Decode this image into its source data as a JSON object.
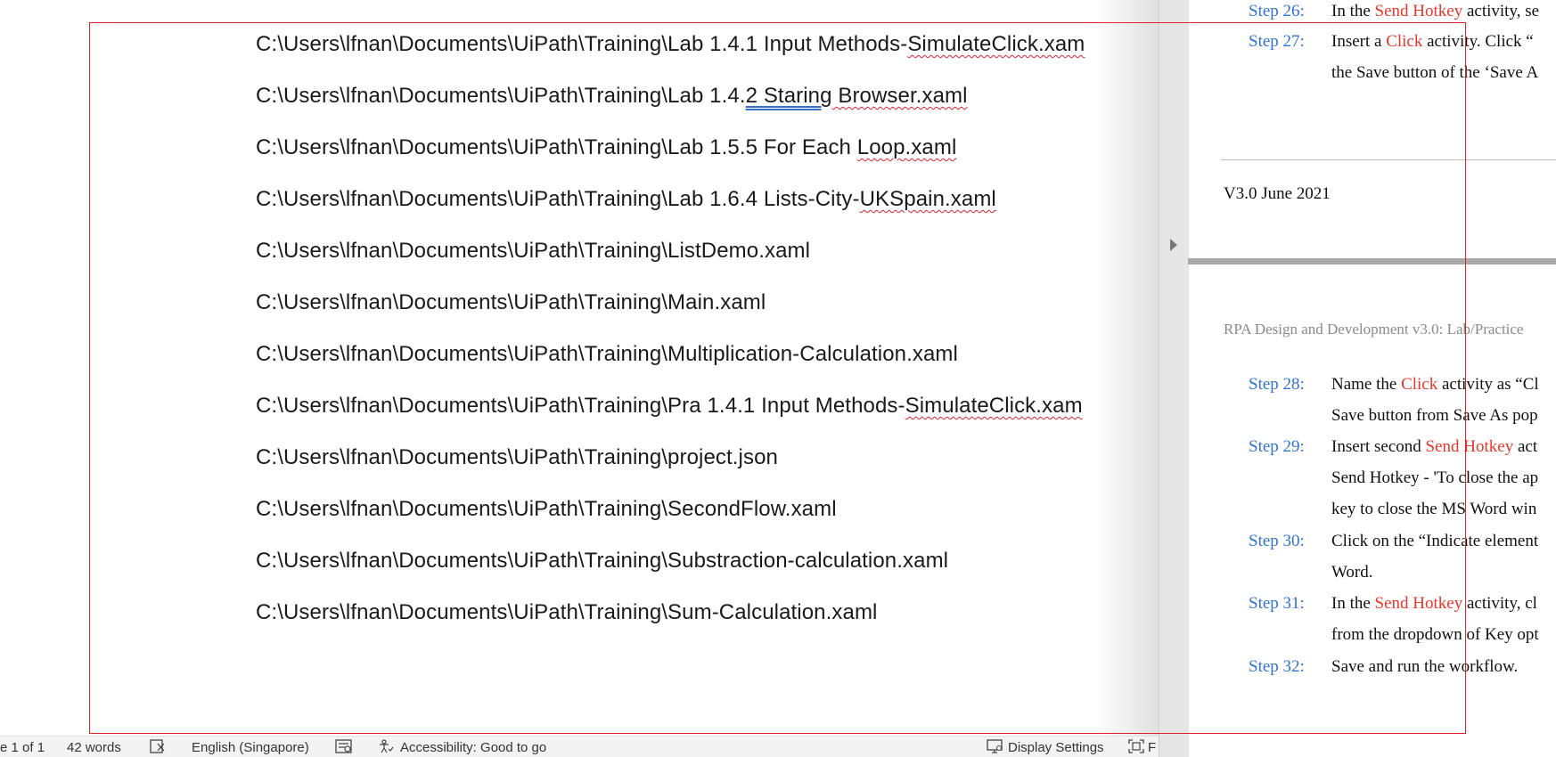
{
  "document": {
    "paths": [
      {
        "prefix": "C:\\Users\\lfnan\\Documents\\UiPath\\Training\\Lab 1.4.1 Input Methods-",
        "flag": "SimulateClick.xam",
        "suffix": ""
      },
      {
        "prefix": "C:\\Users\\lfnan\\Documents\\UiPath\\Training\\Lab 1.4.",
        "flag": "2  Staring",
        "suffix": " Browser.xaml"
      },
      {
        "prefix": "C:\\Users\\lfnan\\Documents\\UiPath\\Training\\Lab 1.5.5 For Each ",
        "flag": "Loop.xaml",
        "suffix": ""
      },
      {
        "prefix": "C:\\Users\\lfnan\\Documents\\UiPath\\Training\\Lab 1.6.4 Lists-City-",
        "flag": "UKSpain.xaml",
        "suffix": ""
      },
      {
        "prefix": "C:\\Users\\lfnan\\Documents\\UiPath\\Training\\ListDemo.xaml",
        "flag": "",
        "suffix": ""
      },
      {
        "prefix": "C:\\Users\\lfnan\\Documents\\UiPath\\Training\\Main.xaml",
        "flag": "",
        "suffix": ""
      },
      {
        "prefix": "C:\\Users\\lfnan\\Documents\\UiPath\\Training\\Multiplication-Calculation.xaml",
        "flag": "",
        "suffix": ""
      },
      {
        "prefix": "C:\\Users\\lfnan\\Documents\\UiPath\\Training\\Pra 1.4.1 Input Methods-",
        "flag": "SimulateClick.xam",
        "suffix": ""
      },
      {
        "prefix": "C:\\Users\\lfnan\\Documents\\UiPath\\Training\\project.json",
        "flag": "",
        "suffix": ""
      },
      {
        "prefix": "C:\\Users\\lfnan\\Documents\\UiPath\\Training\\SecondFlow.xaml",
        "flag": "",
        "suffix": ""
      },
      {
        "prefix": "C:\\Users\\lfnan\\Documents\\UiPath\\Training\\Substraction-calculation.xaml",
        "flag": "",
        "suffix": ""
      },
      {
        "prefix": "C:\\Users\\lfnan\\Documents\\UiPath\\Training\\Sum-Calculation.xaml",
        "flag": "",
        "suffix": ""
      }
    ]
  },
  "status_bar": {
    "page": "e 1 of 1",
    "words": "42 words",
    "language": "English (Singapore)",
    "accessibility": "Accessibility: Good to go",
    "display_settings": "Display Settings",
    "focus_partial": "F"
  },
  "pdf": {
    "steps_top": [
      {
        "label": "Step 26:",
        "lines": [
          [
            "In the ",
            ""
          ],
          [
            "Send Hotkey",
            "red"
          ],
          [
            " activity, se",
            ""
          ]
        ]
      },
      {
        "label": "Step 27:",
        "lines": [
          [
            "Insert a ",
            ""
          ],
          [
            "Click",
            "red"
          ],
          [
            " activity. Click “",
            ""
          ]
        ],
        "line2": "the Save button of the ‘Save A"
      }
    ],
    "version": "V3.0 June 2021",
    "header": "RPA Design and Development v3.0: Lab/Practice",
    "steps_bottom": [
      {
        "label": "Step 28:",
        "line1": [
          [
            "Name the ",
            ""
          ],
          [
            "Click",
            "red"
          ],
          [
            " activity as “Cl",
            ""
          ]
        ],
        "line2": "Save button from Save As pop"
      },
      {
        "label": "Step 29:",
        "line1": [
          [
            "Insert second ",
            ""
          ],
          [
            "Send Hotkey",
            "red"
          ],
          [
            " act",
            ""
          ]
        ],
        "line2": "Send Hotkey - 'To close the ap",
        "line3": "key to close the MS Word win"
      },
      {
        "label": "Step 30:",
        "line1": [
          [
            "Click on the “Indicate element",
            ""
          ]
        ],
        "line2": "Word."
      },
      {
        "label": "Step 31:",
        "line1": [
          [
            "In the ",
            ""
          ],
          [
            "Send Hotkey",
            "red"
          ],
          [
            " activity, cl",
            ""
          ]
        ],
        "line2": "from the dropdown of Key opt"
      },
      {
        "label": "Step 32:",
        "line1": [
          [
            "Save and run the workflow.",
            ""
          ]
        ]
      }
    ]
  },
  "colors": {
    "annotation_box": "#e0202a",
    "step_label": "#2e72d2",
    "activity_name": "#e8372a"
  }
}
